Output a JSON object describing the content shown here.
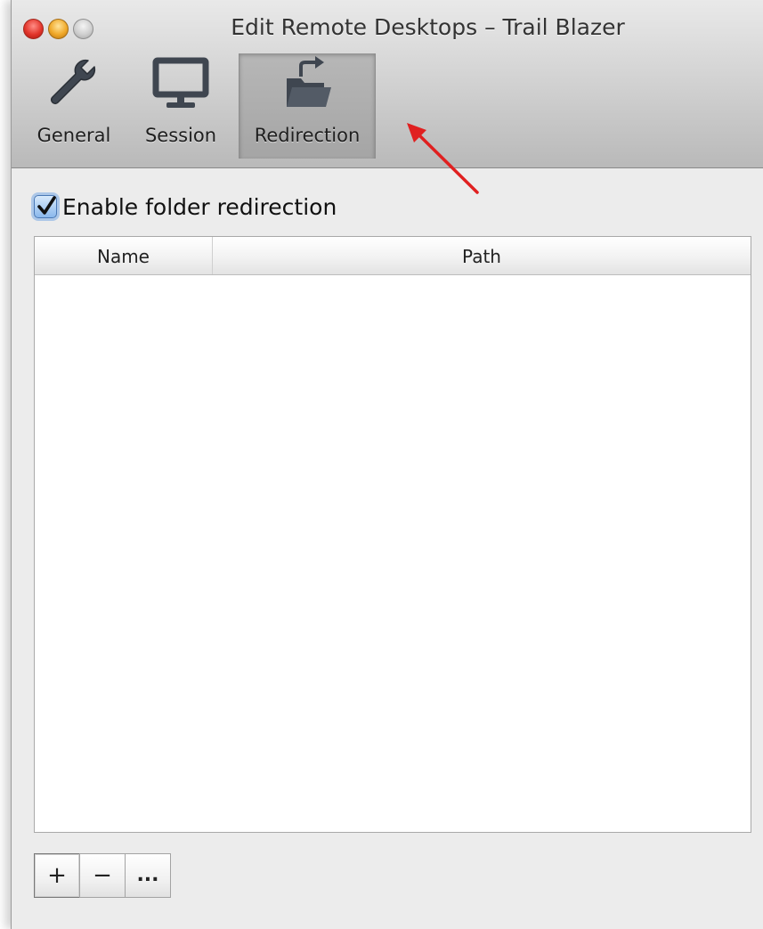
{
  "window": {
    "title": "Edit Remote Desktops – Trail Blazer"
  },
  "toolbar": {
    "tabs": [
      {
        "label": "General",
        "icon": "wrench-icon",
        "selected": false
      },
      {
        "label": "Session",
        "icon": "monitor-icon",
        "selected": false
      },
      {
        "label": "Redirection",
        "icon": "folder-redirect-icon",
        "selected": true
      }
    ]
  },
  "redirection": {
    "enable_label": "Enable folder redirection",
    "enabled": true
  },
  "table": {
    "columns": [
      "Name",
      "Path"
    ],
    "rows": []
  },
  "buttons": {
    "add": "+",
    "remove": "−",
    "more": "..."
  },
  "colors": {
    "annotation_arrow": "#e02020",
    "checkbox_accent": "#4a78b5"
  }
}
